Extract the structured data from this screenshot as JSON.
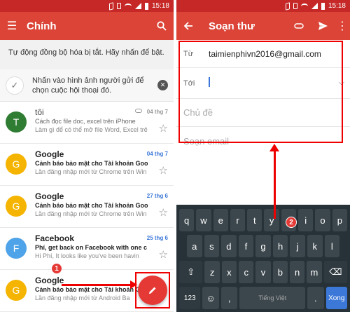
{
  "status_bar": {
    "time_left": "15:18",
    "time_right": "15:18"
  },
  "inbox": {
    "title": "Chính",
    "sync_banner": "Tự động đồng bộ hóa bị tắt. Hãy nhấn để bật.",
    "tip": "Nhấn vào hình ảnh người gửi để chọn cuộc hội thoại đó.",
    "mails": [
      {
        "initial": "T",
        "avatar_color": "#2e7d32",
        "sender": "tôi",
        "subject": "Cách đọc file doc, excel trên iPhone",
        "snippet": "Làm gì để có thể mở file Word, Excel trê",
        "date": "04 thg 7",
        "unread": false,
        "attachment": true
      },
      {
        "initial": "G",
        "avatar_color": "#f4b400",
        "sender": "Google",
        "subject": "Cảnh báo bảo mật cho Tài khoản Goo",
        "snippet": "Lần đăng nhập mới từ Chrome trên Win",
        "date": "04 thg 7",
        "unread": true,
        "attachment": false
      },
      {
        "initial": "G",
        "avatar_color": "#f4b400",
        "sender": "Google",
        "subject": "Cảnh báo bảo mật cho Tài khoản Goo",
        "snippet": "Lần đăng nhập mới từ Chrome trên Win",
        "date": "27 thg 6",
        "unread": true,
        "attachment": false
      },
      {
        "initial": "F",
        "avatar_color": "#4fa3e8",
        "sender": "Facebook",
        "subject": "Phí, get back on Facebook with one c",
        "snippet": "Hi Phí, It looks like you've been havin",
        "date": "25 thg 6",
        "unread": true,
        "attachment": false
      },
      {
        "initial": "G",
        "avatar_color": "#f4b400",
        "sender": "Google",
        "subject": "Cảnh báo bảo mật cho Tài khoản Goo",
        "snippet": "Lần đăng nhập mới từ Android Ba",
        "date": "",
        "unread": true,
        "attachment": false
      }
    ],
    "step_badge": "1"
  },
  "compose": {
    "title": "Soạn thư",
    "from_label": "Từ",
    "from_value": "taimienphivn2016@gmail.com",
    "to_label": "Tới",
    "subject_placeholder": "Chủ đề",
    "body_placeholder": "Soạn email",
    "step_badge": "2"
  },
  "keyboard": {
    "row1": [
      "q",
      "w",
      "e",
      "r",
      "t",
      "y",
      "u",
      "i",
      "o",
      "p"
    ],
    "row2": [
      "a",
      "s",
      "d",
      "f",
      "g",
      "h",
      "j",
      "k",
      "l"
    ],
    "row3": [
      "z",
      "x",
      "c",
      "v",
      "b",
      "n",
      "m"
    ],
    "shift": "⇧",
    "backspace": "⌫",
    "num_key": "123",
    "emoji_key": "☺",
    "comma": ",",
    "space_label": "Tiếng Việt",
    "period": ".",
    "done_key": "Xong"
  }
}
